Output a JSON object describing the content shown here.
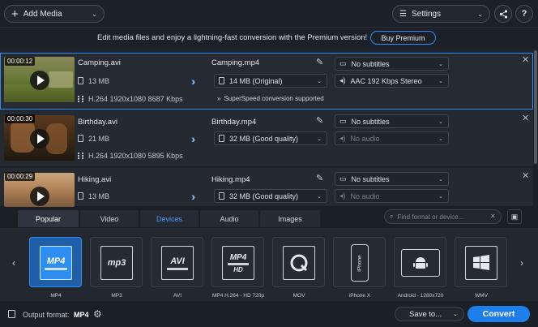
{
  "toolbar": {
    "add_media_label": "Add Media",
    "settings_label": "Settings"
  },
  "promo": {
    "text": "Edit media files and enjoy a lightning-fast conversion with the Premium version!",
    "button": "Buy Premium"
  },
  "files": [
    {
      "duration": "00:00:12",
      "name": "Camping.avi",
      "size": "13 MB",
      "codec": "H.264 1920x1080 8687 Kbps",
      "output_name": "Camping.mp4",
      "output_size": "14 MB (Original)",
      "subtitles": "No subtitles",
      "audio": "AAC 192 Kbps Stereo",
      "note": "SuperSpeed conversion supported"
    },
    {
      "duration": "00:00:30",
      "name": "Birthday.avi",
      "size": "21 MB",
      "codec": "H.264 1920x1080 5895 Kbps",
      "output_name": "Birthday.mp4",
      "output_size": "32 MB (Good quality)",
      "subtitles": "No subtitles",
      "audio": "No audio"
    },
    {
      "duration": "00:00:29",
      "name": "Hiking.avi",
      "size": "13 MB",
      "output_name": "Hiking.mp4",
      "output_size": "32 MB (Good quality)",
      "subtitles": "No subtitles",
      "audio": "No audio"
    }
  ],
  "tabs": [
    "Popular",
    "Video",
    "Devices",
    "Audio",
    "Images"
  ],
  "active_tab": "Popular",
  "search": {
    "placeholder": "Find format or device..."
  },
  "formats": [
    {
      "label": "MP4",
      "icon": "mp4-icon",
      "icon_text": "MP4"
    },
    {
      "label": "MP3",
      "icon": "mp3-icon",
      "icon_text": "mp3"
    },
    {
      "label": "AVI",
      "icon": "avi-icon",
      "icon_text": "AVI"
    },
    {
      "label": "MP4 H.264 - HD 720p",
      "icon": "mp4-hd-icon",
      "icon_text": "MP4"
    },
    {
      "label": "MOV",
      "icon": "quicktime-icon",
      "icon_text": ""
    },
    {
      "label": "iPhone X",
      "icon": "iphone-icon",
      "icon_text": "iPhone"
    },
    {
      "label": "Android - 1280x720",
      "icon": "android-icon",
      "icon_text": ""
    },
    {
      "label": "WMV",
      "icon": "windows-icon",
      "icon_text": ""
    }
  ],
  "footer": {
    "output_format_label": "Output format:",
    "output_format_value": "MP4",
    "save_to_label": "Save to...",
    "convert_label": "Convert"
  },
  "colors": {
    "accent": "#1f7fea",
    "background": "#1f232b",
    "selected_border": "#2f8cf5"
  }
}
